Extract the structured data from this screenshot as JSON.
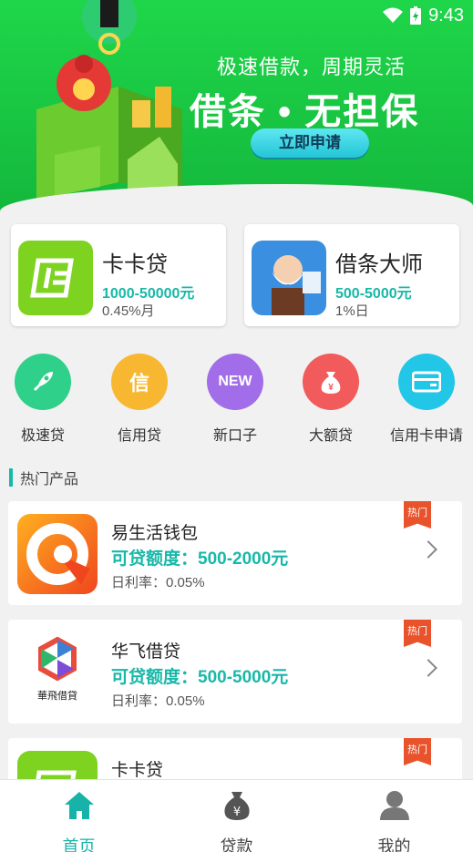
{
  "status": {
    "time": "9:43"
  },
  "banner": {
    "subtitle": "极速借款，周期灵活",
    "title": "借条 • 无担保",
    "cta": "立即申请",
    "slides": 3,
    "active_slide": 1
  },
  "featured": [
    {
      "name": "卡卡贷",
      "amount": "1000-50000元",
      "rate": "0.45%月",
      "logo_color": "#7ed321"
    },
    {
      "name": "借条大师",
      "amount": "500-5000元",
      "rate": "1%日",
      "logo_color": "#3b8fe0"
    }
  ],
  "categories": [
    {
      "label": "极速贷",
      "icon": "rocket-icon",
      "color": "#2fd08a"
    },
    {
      "label": "信用贷",
      "icon": "xin-icon",
      "glyph": "信",
      "color": "#f7b731"
    },
    {
      "label": "新口子",
      "icon": "new-icon",
      "glyph": "NEW",
      "color": "#a26de8"
    },
    {
      "label": "大额贷",
      "icon": "money-bag-icon",
      "color": "#f25b5b"
    },
    {
      "label": "信用卡申请",
      "icon": "credit-card-icon",
      "color": "#22c6e6"
    }
  ],
  "section": {
    "title": "热门产品"
  },
  "products": [
    {
      "name": "易生活钱包",
      "amount_label": "可贷额度：500-2000元",
      "rate_label": "日利率：0.05%",
      "badge": "热门"
    },
    {
      "name": "华飞借贷",
      "amount_label": "可贷额度：500-5000元",
      "rate_label": "日利率：0.05%",
      "badge": "热门",
      "logo_caption": "華飛借貸"
    },
    {
      "name": "卡卡贷",
      "amount_label": "",
      "rate_label": "",
      "badge": "热门"
    }
  ],
  "nav": [
    {
      "label": "首页",
      "icon": "home-icon",
      "active": true
    },
    {
      "label": "贷款",
      "icon": "loan-bag-icon",
      "active": false
    },
    {
      "label": "我的",
      "icon": "user-icon",
      "active": false
    }
  ],
  "colors": {
    "accent": "#18b8a8",
    "banner": "#1fd64a",
    "hot": "#e8532c"
  }
}
